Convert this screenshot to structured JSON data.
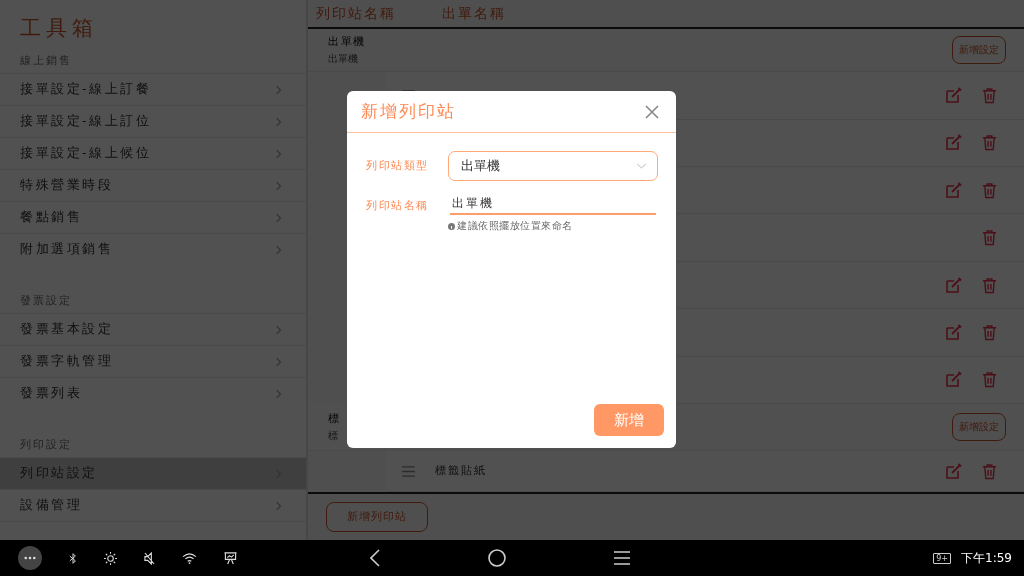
{
  "sidebar": {
    "title": "工具箱",
    "sections": [
      {
        "heading": "線上銷售",
        "items": [
          {
            "label": "接單設定-線上訂餐",
            "selected": false
          },
          {
            "label": "接單設定-線上訂位",
            "selected": false
          },
          {
            "label": "接單設定-線上候位",
            "selected": false
          },
          {
            "label": "特殊營業時段",
            "selected": false
          },
          {
            "label": "餐點銷售",
            "selected": false
          },
          {
            "label": "附加選項銷售",
            "selected": false
          }
        ]
      },
      {
        "heading": "發票設定",
        "items": [
          {
            "label": "發票基本設定",
            "selected": false
          },
          {
            "label": "發票字軌管理",
            "selected": false
          },
          {
            "label": "發票列表",
            "selected": false
          }
        ]
      },
      {
        "heading": "列印設定",
        "items": [
          {
            "label": "列印站設定",
            "selected": true
          },
          {
            "label": "設備管理",
            "selected": false
          }
        ]
      }
    ]
  },
  "table": {
    "columns": [
      "列印站名稱",
      "出單名稱"
    ],
    "groups": [
      {
        "name": "出單機",
        "subname": "出單機",
        "button": "新增設定",
        "items": [
          {
            "editable": true
          },
          {
            "editable": true
          },
          {
            "editable": true
          },
          {
            "editable": false
          },
          {
            "editable": true
          },
          {
            "editable": true
          },
          {
            "editable": true
          }
        ]
      },
      {
        "name": "標",
        "subname": "標",
        "button": "新增設定",
        "items": [
          {
            "label": "標籤貼紙",
            "editable": true
          }
        ]
      }
    ]
  },
  "add_station_button": "新增列印站",
  "dialog": {
    "title": "新增列印站",
    "fields": [
      {
        "kind": "select",
        "label": "列印站類型",
        "value": "出單機"
      },
      {
        "kind": "text",
        "label": "列印站名稱",
        "value": "出單機",
        "hint": "建議依照擺放位置來命名"
      }
    ],
    "submit": "新增"
  },
  "status_bar": {
    "notification_badge": "9+",
    "time": "下午1:59"
  }
}
